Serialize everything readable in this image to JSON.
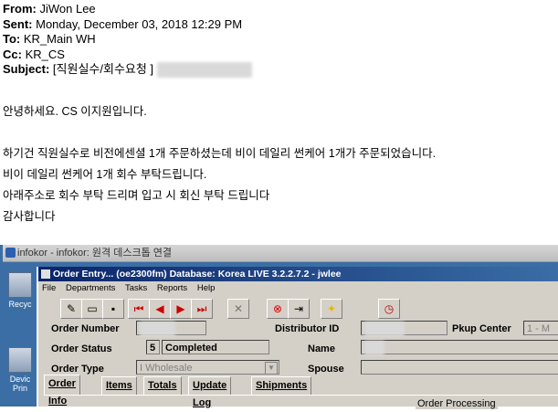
{
  "email": {
    "from_label": "From:",
    "from": "JiWon Lee",
    "sent_label": "Sent:",
    "sent": "Monday, December 03, 2018 12:29 PM",
    "to_label": "To:",
    "to": "KR_Main WH",
    "cc_label": "Cc:",
    "cc": "KR_CS",
    "subject_label": "Subject:",
    "subject": "[직원실수/회수요청 ]",
    "greeting": "안녕하세요. CS 이지원입니다.",
    "line1": "하기건 직원실수로 비전에센셜 1개 주문하셨는데 비이 데일리 썬케어 1개가 주문되었습니다.",
    "line2": "비이 데일리 썬케어 1개 회수 부탁드립니다.",
    "line3": "아래주소로 회수 부탁 드리며 입고 시 회신 부탁 드립니다",
    "closing": "감사합니다"
  },
  "remote_desktop": {
    "title": "infokor - infokor: 원격 데스크톱 연결",
    "desktop_icons": [
      "Recyc",
      "Devic Prin"
    ]
  },
  "app": {
    "title": "Order Entry... (oe2300fm)  Database: Korea LIVE 3.2.2.7.2 - jwlee",
    "menu": [
      "File",
      "Departments",
      "Tasks",
      "Reports",
      "Help"
    ],
    "fields": {
      "order_number_label": "Order Number",
      "distributor_id_label": "Distributor ID",
      "pkup_center_label": "Pkup Center",
      "pkup_center_value": "1 - M",
      "order_status_label": "Order Status",
      "order_status_code": "5",
      "order_status_value": "Completed",
      "name_label": "Name",
      "order_type_label": "Order Type",
      "order_type_value": "I Wholesale",
      "spouse_label": "Spouse"
    },
    "tabs": [
      "Order Info",
      "Items",
      "Totals",
      "Update Log",
      "Shipments"
    ],
    "section_label": "Order Processing"
  }
}
